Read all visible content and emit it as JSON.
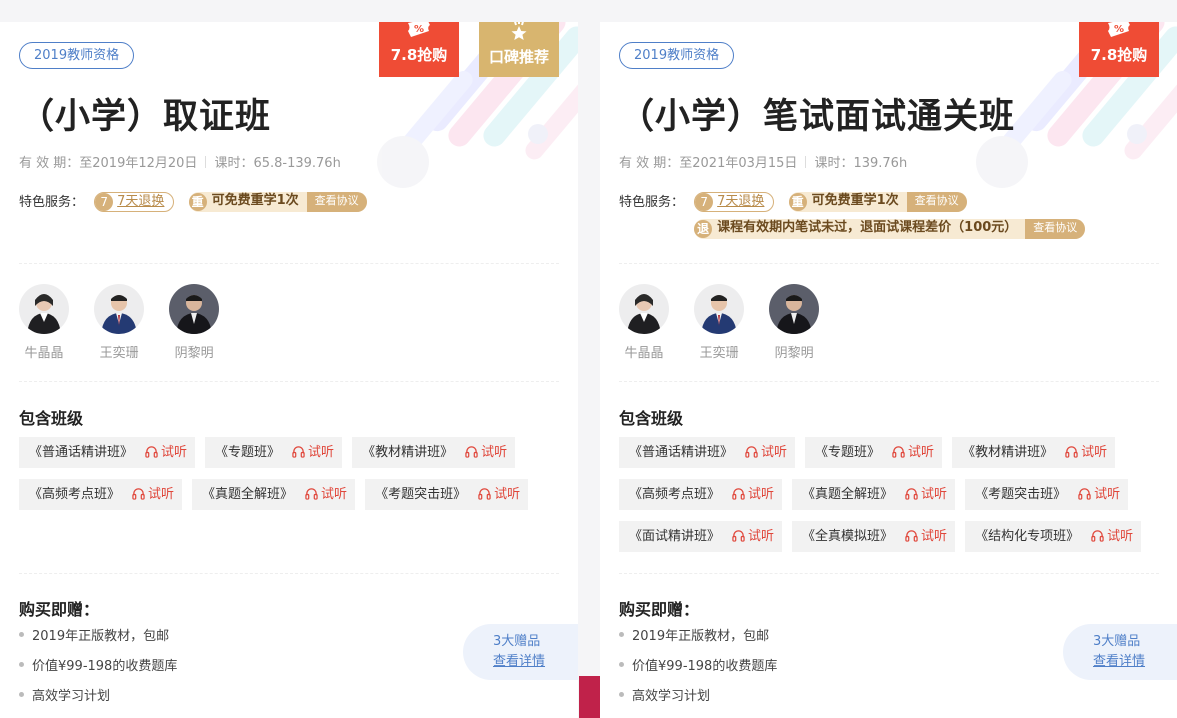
{
  "cards": [
    {
      "tag": "2019教师资格",
      "title": "（小学）取证班",
      "validity_label": "有 效 期：",
      "validity_value": "至2019年12月20日",
      "hours_label": "课时：",
      "hours_value": "65.8-139.76h",
      "services_label": "特色服务：",
      "service_refund_num": "7",
      "service_refund": "7天退换",
      "service_relearn_num": "重",
      "service_relearn": "可免费重学1次",
      "service_relearn_link": "查看协议",
      "teachers": [
        "牛晶晶",
        "王奕珊",
        "阴黎明"
      ],
      "classes_title": "包含班级",
      "classes": [
        "《普通话精讲班》",
        "《专题班》",
        "《教材精讲班》",
        "《高频考点班》",
        "《真题全解班》",
        "《考题突击班》"
      ],
      "try_label": "试听",
      "gifts_title": "购买即赠：",
      "gifts": [
        "2019年正版教材，包邮",
        "价值¥99-198的收费题库",
        "高效学习计划"
      ],
      "gift_count": "3大赠品",
      "gift_link": "查看详情",
      "badges": [
        {
          "label": "7.8抢购",
          "icon": "discount-ticket-icon",
          "color": "#ef4c35"
        },
        {
          "label": "口碑推荐",
          "icon": "medal-star-icon",
          "color": "#d8b56f"
        }
      ]
    },
    {
      "tag": "2019教师资格",
      "title": "（小学）笔试面试通关班",
      "validity_label": "有 效 期：",
      "validity_value": "至2021年03月15日",
      "hours_label": "课时：",
      "hours_value": "139.76h",
      "services_label": "特色服务：",
      "service_refund_num": "7",
      "service_refund": "7天退换",
      "service_relearn_num": "重",
      "service_relearn": "可免费重学1次",
      "service_relearn_link": "查看协议",
      "service_guarantee_num": "退",
      "service_guarantee": "课程有效期内笔试未过，退面试课程差价（100元）",
      "service_guarantee_link": "查看协议",
      "teachers": [
        "牛晶晶",
        "王奕珊",
        "阴黎明"
      ],
      "classes_title": "包含班级",
      "classes": [
        "《普通话精讲班》",
        "《专题班》",
        "《教材精讲班》",
        "《高频考点班》",
        "《真题全解班》",
        "《考题突击班》",
        "《面试精讲班》",
        "《全真模拟班》",
        "《结构化专项班》"
      ],
      "try_label": "试听",
      "gifts_title": "购买即赠：",
      "gifts": [
        "2019年正版教材，包邮",
        "价值¥99-198的收费题库",
        "高效学习计划"
      ],
      "gift_count": "3大赠品",
      "gift_link": "查看详情",
      "badges": [
        {
          "label": "7.8抢购",
          "icon": "discount-ticket-icon",
          "color": "#ef4c35"
        }
      ]
    }
  ]
}
